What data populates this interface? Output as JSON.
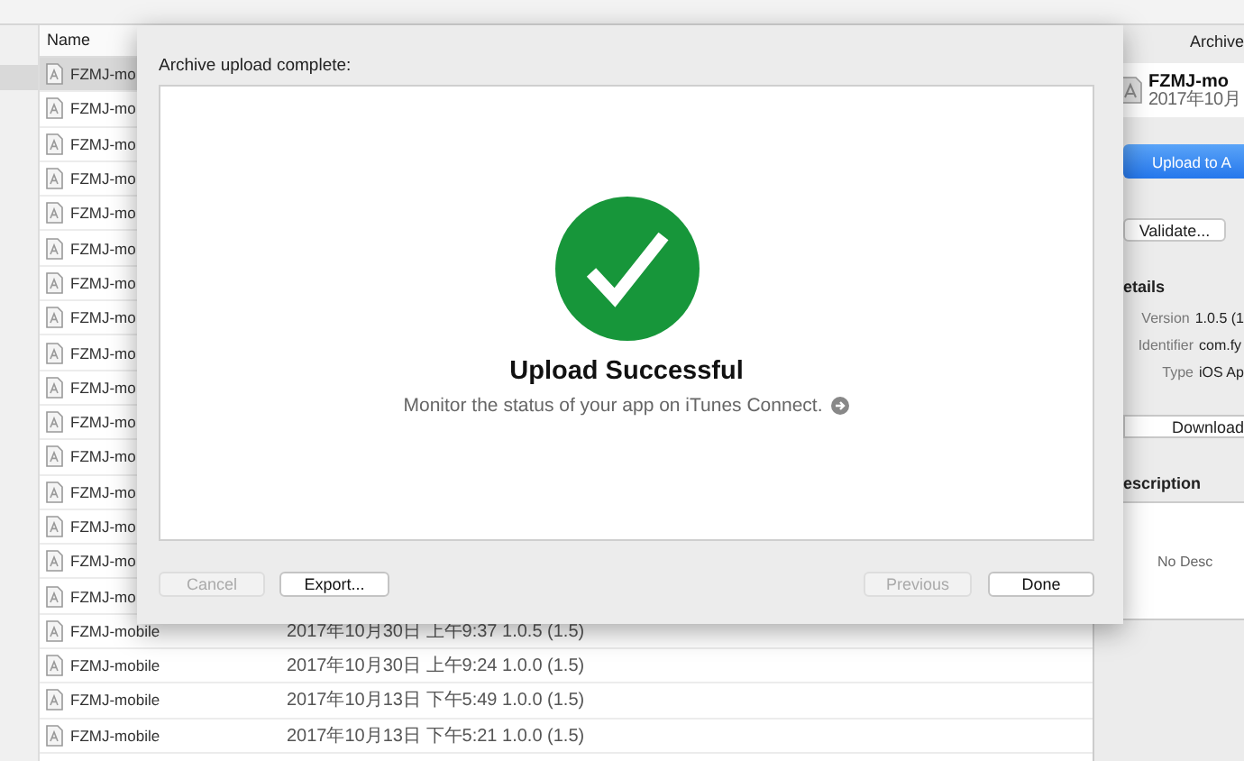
{
  "list": {
    "column_header": "Name",
    "rows": [
      {
        "name": "FZMJ-mo",
        "selected": true
      },
      {
        "name": "FZMJ-mo",
        "selected": false
      },
      {
        "name": "FZMJ-mo",
        "selected": false
      },
      {
        "name": "FZMJ-mo",
        "selected": false
      },
      {
        "name": "FZMJ-mo",
        "selected": false
      },
      {
        "name": "FZMJ-mo",
        "selected": false
      },
      {
        "name": "FZMJ-mo",
        "selected": false
      },
      {
        "name": "FZMJ-mo",
        "selected": false
      },
      {
        "name": "FZMJ-mo",
        "selected": false
      },
      {
        "name": "FZMJ-mo",
        "selected": false
      },
      {
        "name": "FZMJ-mo",
        "selected": false
      },
      {
        "name": "FZMJ-mo",
        "selected": false
      },
      {
        "name": "FZMJ-mo",
        "selected": false
      },
      {
        "name": "FZMJ-mo",
        "selected": false
      },
      {
        "name": "FZMJ-mo",
        "selected": false
      },
      {
        "name": "FZMJ-mo",
        "selected": false
      },
      {
        "name": "FZMJ-mobile",
        "date": "2017年10月30日 上午9:37 1.0.5 (1.5)",
        "selected": false
      },
      {
        "name": "FZMJ-mobile",
        "date": "2017年10月30日 上午9:24 1.0.0 (1.5)",
        "selected": false
      },
      {
        "name": "FZMJ-mobile",
        "date": "2017年10月13日 下午5:49 1.0.0 (1.5)",
        "selected": false
      },
      {
        "name": "FZMJ-mobile",
        "date": "2017年10月13日 下午5:21 1.0.0 (1.5)",
        "selected": false
      }
    ]
  },
  "inspector": {
    "header": "Archive",
    "archive_name": "FZMJ-mo",
    "archive_date": "2017年10月",
    "upload_button": "Upload to A",
    "validate_button": "Validate...",
    "details_heading": "etails",
    "details": [
      {
        "label": "Version",
        "value": "1.0.5 (1"
      },
      {
        "label": "Identifier",
        "value": "com.fy"
      },
      {
        "label": "Type",
        "value": "iOS Ap"
      }
    ],
    "download_button": "Download",
    "description_heading": "escription",
    "description_placeholder": "No Desc"
  },
  "dialog": {
    "title": "Archive upload complete:",
    "heading": "Upload Successful",
    "message": "Monitor the status of your app on iTunes Connect.",
    "buttons": [
      {
        "label": "Cancel",
        "disabled": true
      },
      {
        "label": "Export...",
        "disabled": false
      },
      {
        "label": "Previous",
        "disabled": true
      },
      {
        "label": "Done",
        "disabled": false
      }
    ]
  }
}
